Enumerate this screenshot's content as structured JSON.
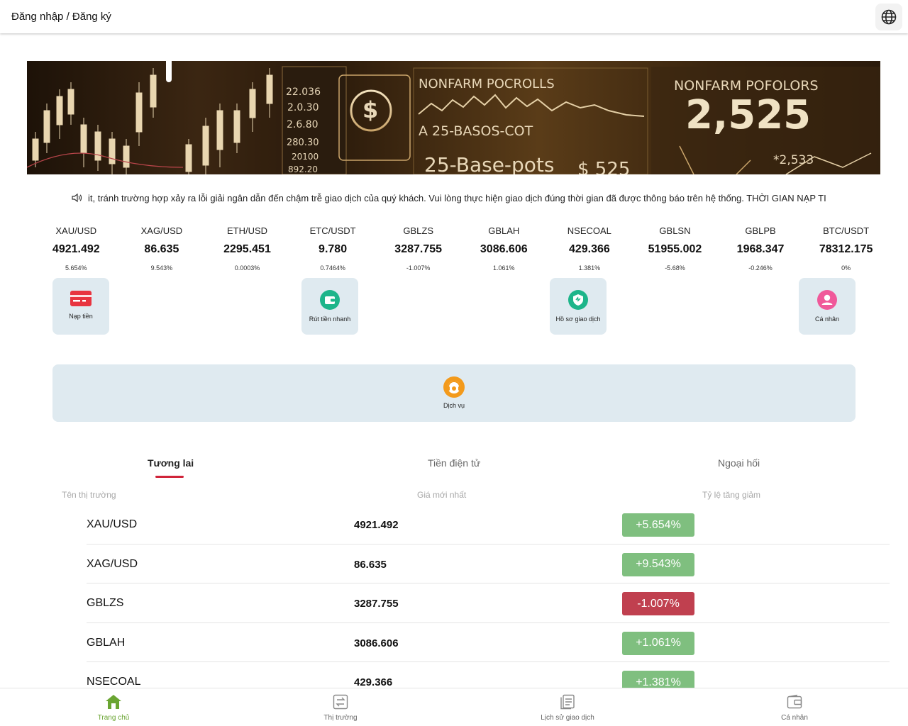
{
  "header": {
    "login_label": "Đăng nhập / Đăng ký",
    "language_icon": "globe-icon"
  },
  "banner": {
    "texts": [
      "NONFARM POCROLLS",
      "NONFARM POFOLORS",
      "A 25-BASOS-COT",
      "2,525",
      "25-Base-pots",
      "$ 525",
      "22.036",
      "2.0.30",
      "2.6.80",
      "280.30",
      "20100",
      "892.20",
      "*2,533"
    ]
  },
  "notice": {
    "icon": "speaker-icon",
    "text": "it, tránh trường hợp xảy ra lỗi giải ngân dẫn đến chậm trễ giao dịch của quý khách. Vui lòng thực hiện giao dịch đúng thời gian đã được thông báo trên hệ thống. THỜI GIAN NẠP TI"
  },
  "ticker": [
    {
      "symbol": "XAU/USD",
      "price": "4921.492",
      "change": "5.654%"
    },
    {
      "symbol": "XAG/USD",
      "price": "86.635",
      "change": "9.543%"
    },
    {
      "symbol": "ETH/USD",
      "price": "2295.451",
      "change": "0.0003%"
    },
    {
      "symbol": "ETC/USDT",
      "price": "9.780",
      "change": "0.7464%"
    },
    {
      "symbol": "GBLZS",
      "price": "3287.755",
      "change": "-1.007%"
    },
    {
      "symbol": "GBLAH",
      "price": "3086.606",
      "change": "1.061%"
    },
    {
      "symbol": "NSECOAL",
      "price": "429.366",
      "change": "1.381%"
    },
    {
      "symbol": "GBLSN",
      "price": "51955.002",
      "change": "-5.68%"
    },
    {
      "symbol": "GBLPB",
      "price": "1968.347",
      "change": "-0.246%"
    },
    {
      "symbol": "BTC/USDT",
      "price": "78312.175",
      "change": "0%"
    }
  ],
  "quick_actions": {
    "deposit": "Nạp tiền",
    "withdraw": "Rút tiền nhanh",
    "records": "Hồ sơ giao dịch",
    "profile": "Cá nhân",
    "service": "Dịch vụ"
  },
  "tabs": {
    "futures": "Tương lai",
    "crypto": "Tiền điện tử",
    "forex": "Ngoại hối"
  },
  "columns": {
    "market": "Tên thị trường",
    "latest": "Giá mới nhất",
    "change": "Tỷ lệ tăng giảm"
  },
  "market_rows": [
    {
      "name": "XAU/USD",
      "price": "4921.492",
      "change": "+5.654%",
      "direction": "up"
    },
    {
      "name": "XAG/USD",
      "price": "86.635",
      "change": "+9.543%",
      "direction": "up"
    },
    {
      "name": "GBLZS",
      "price": "3287.755",
      "change": "-1.007%",
      "direction": "down"
    },
    {
      "name": "GBLAH",
      "price": "3086.606",
      "change": "+1.061%",
      "direction": "up"
    },
    {
      "name": "NSECOAL",
      "price": "429.366",
      "change": "+1.381%",
      "direction": "up"
    }
  ],
  "colors": {
    "accent_red": "#d0243a",
    "up_green": "#7fbf7f",
    "down_red": "#c0404f",
    "nav_active": "#6aa532",
    "card_bg": "#dfeaf0"
  },
  "bottom_nav": {
    "home": "Trang chủ",
    "market": "Thị trường",
    "history": "Lịch sử giao dịch",
    "me": "Cá nhân"
  }
}
